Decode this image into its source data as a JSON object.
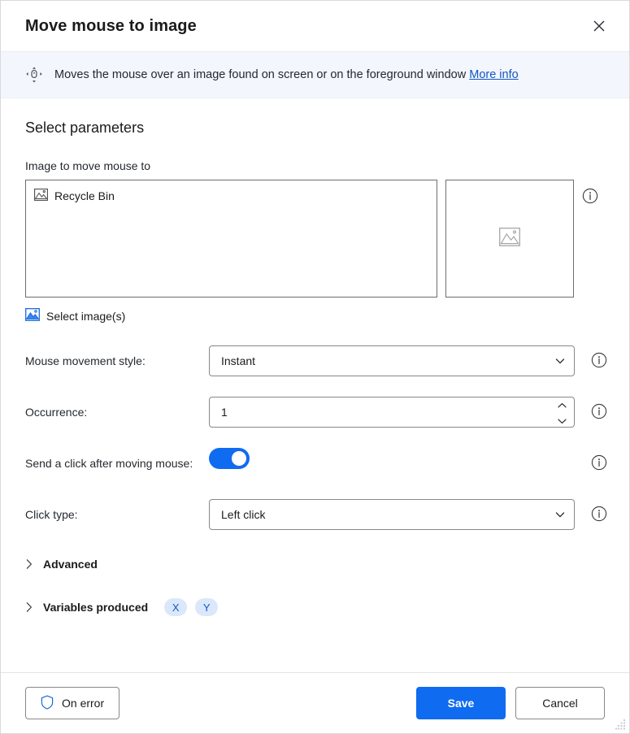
{
  "window": {
    "title": "Move mouse to image",
    "close_icon": "close-icon"
  },
  "banner": {
    "icon": "move-mouse-icon",
    "text": "Moves the mouse over an image found on screen or on the foreground window",
    "link_label": "More info"
  },
  "main": {
    "section_title": "Select parameters",
    "image_field": {
      "label": "Image to move mouse to",
      "items": [
        {
          "icon": "image-icon",
          "label": "Recycle Bin"
        }
      ],
      "preview_placeholder_icon": "image-placeholder-icon",
      "info_icon": "info-icon"
    },
    "select_images_link": {
      "icon": "image-icon-blue",
      "label": "Select image(s)"
    },
    "rows": [
      {
        "name": "mouse-movement-style",
        "label": "Mouse movement style:",
        "type": "dropdown",
        "value": "Instant",
        "info_icon": "info-icon"
      },
      {
        "name": "occurrence",
        "label": "Occurrence:",
        "type": "spinner",
        "value": "1",
        "info_icon": "info-icon"
      },
      {
        "name": "send-click-after-moving-mouse",
        "label": "Send a click after moving mouse:",
        "type": "toggle",
        "value": "on",
        "info_icon": "info-icon"
      },
      {
        "name": "click-type",
        "label": "Click type:",
        "type": "dropdown",
        "value": "Left click",
        "info_icon": "info-icon"
      }
    ],
    "advanced": {
      "label": "Advanced",
      "caret_icon": "chevron-right-icon"
    },
    "variables_produced": {
      "label": "Variables produced",
      "caret_icon": "chevron-right-icon",
      "pills": [
        "X",
        "Y"
      ]
    }
  },
  "footer": {
    "on_error_label": "On error",
    "on_error_icon": "shield-icon",
    "save_label": "Save",
    "cancel_label": "Cancel",
    "resize_grip_icon": "resize-grip-icon"
  },
  "colors": {
    "accent": "#0f6cf0",
    "link": "#1256c4",
    "banner_bg": "#f3f7fd",
    "pill_bg": "#dbe8fb",
    "pill_text": "#1257c8"
  }
}
